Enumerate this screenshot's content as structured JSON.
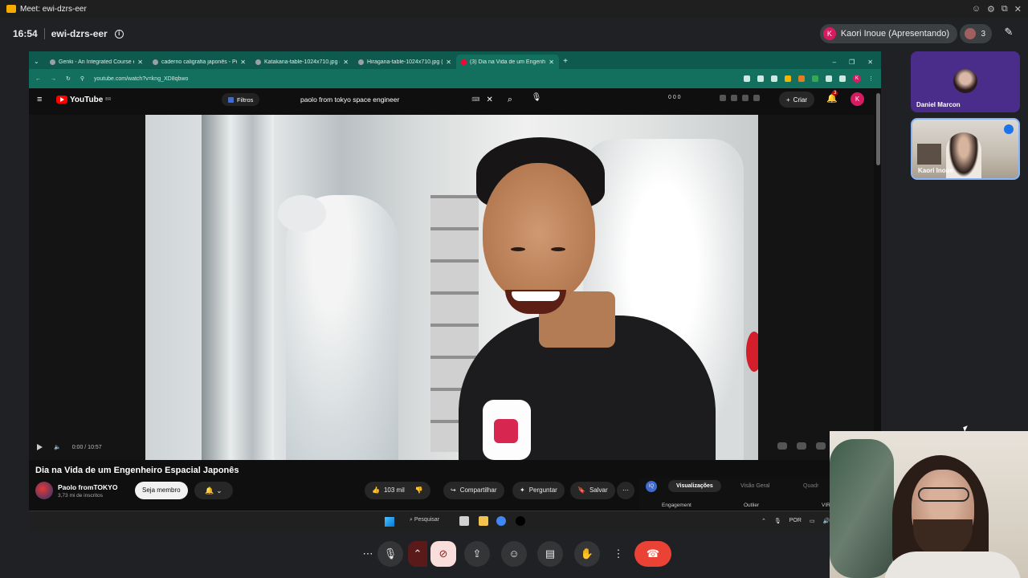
{
  "os_titlebar": {
    "title": "Meet: ewi-dzrs-eer",
    "icons": [
      "emoji-icon",
      "settings-icon",
      "popout-icon",
      "close-icon"
    ]
  },
  "meet": {
    "time": "16:54",
    "code": "ewi-dzrs-eer",
    "presenter_initial": "K",
    "presenter_label": "Kaori Inoue (Apresentando)",
    "participant_count": "3"
  },
  "browser": {
    "tabs": [
      {
        "label": "Genki - An Integrated Course e",
        "active": false
      },
      {
        "label": "caderno caligrafia japonês - Pe",
        "active": false
      },
      {
        "label": "Katakana-table-1024x710.jpg (",
        "active": false
      },
      {
        "label": "Hiragana-table-1024x710.jpg (",
        "active": false
      },
      {
        "label": "(3) Dia na Vida de um Engenhe",
        "active": true
      }
    ],
    "url": "youtube.com/watch?v=kng_XD8qbwo",
    "profile_initial": "K"
  },
  "youtube": {
    "logo": "YouTube",
    "logo_region": "BR",
    "filter_label": "Filtros",
    "search_query": "paolo from tokyo space engineer",
    "stats": "0  0  0",
    "create_label": "Criar",
    "notif_count": "3",
    "avatar_initial": "K",
    "player_time": "0:00 / 10:57",
    "video_title": "Dia na Vida de um Engenheiro Espacial Japonês",
    "channel_name": "Paolo fromTOKYO",
    "channel_subs": "3,73 mi de inscritos",
    "member_label": "Seja membro",
    "like_count": "103 mil",
    "share_label": "Compartilhar",
    "ask_label": "Perguntar",
    "save_label": "Salvar",
    "analytics": {
      "icon_label": "IQ",
      "tab1": "Visualizações",
      "tab2": "Visão Geral",
      "tab3": "Quadr",
      "row_engagement": "Engagement",
      "row_outlier": "Outlier",
      "row_vir": "VIR"
    }
  },
  "taskbar": {
    "search_label": "Pesquisar",
    "lang": "POR"
  },
  "participants": [
    {
      "name": "Daniel Marcon"
    },
    {
      "name": "Kaori Inoue"
    }
  ],
  "controls": {
    "more_options": "more-options",
    "icons": [
      "mic-icon",
      "camera-off-icon",
      "present-icon",
      "emoji-icon",
      "captions-icon",
      "raise-hand-icon",
      "more-vert-icon",
      "hangup-icon"
    ]
  }
}
